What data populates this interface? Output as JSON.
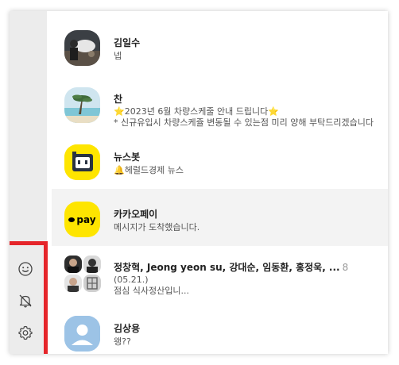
{
  "sidebar": {
    "icons": [
      {
        "name": "emoticon-icon"
      },
      {
        "name": "bell-off-icon"
      },
      {
        "name": "settings-icon"
      }
    ],
    "highlight_color": "#e5252a"
  },
  "chats": [
    {
      "name": "김일수",
      "preview": "넵"
    },
    {
      "name": "찬",
      "preview_star1": "⭐",
      "preview_text": "2023년 6월 차량스케줄 안내 드립니다",
      "preview_star2": "⭐",
      "preview_line2": "* 신규유입시 차량스케쥴 변동될 수 있는점 미리 양해 부탁드리겠습니다"
    },
    {
      "name": "뉴스봇",
      "preview": "🔔헤럴드경제 뉴스"
    },
    {
      "name": "카카오페이",
      "preview": "메시지가 도착했습니다.",
      "avatar_label": "pay"
    },
    {
      "name": "정창혁, Jeong yeon su, 강대순, 임동환, 홍정욱, ...",
      "count": "8",
      "preview_line1": "(05.21.)",
      "preview_line2": "점심 식사정산입니..."
    },
    {
      "name": "김상용",
      "preview": "왱??"
    }
  ],
  "colors": {
    "kakao_yellow": "#fee500",
    "active_row": "#f3f3f3",
    "sidebar_bg": "#ececec"
  }
}
